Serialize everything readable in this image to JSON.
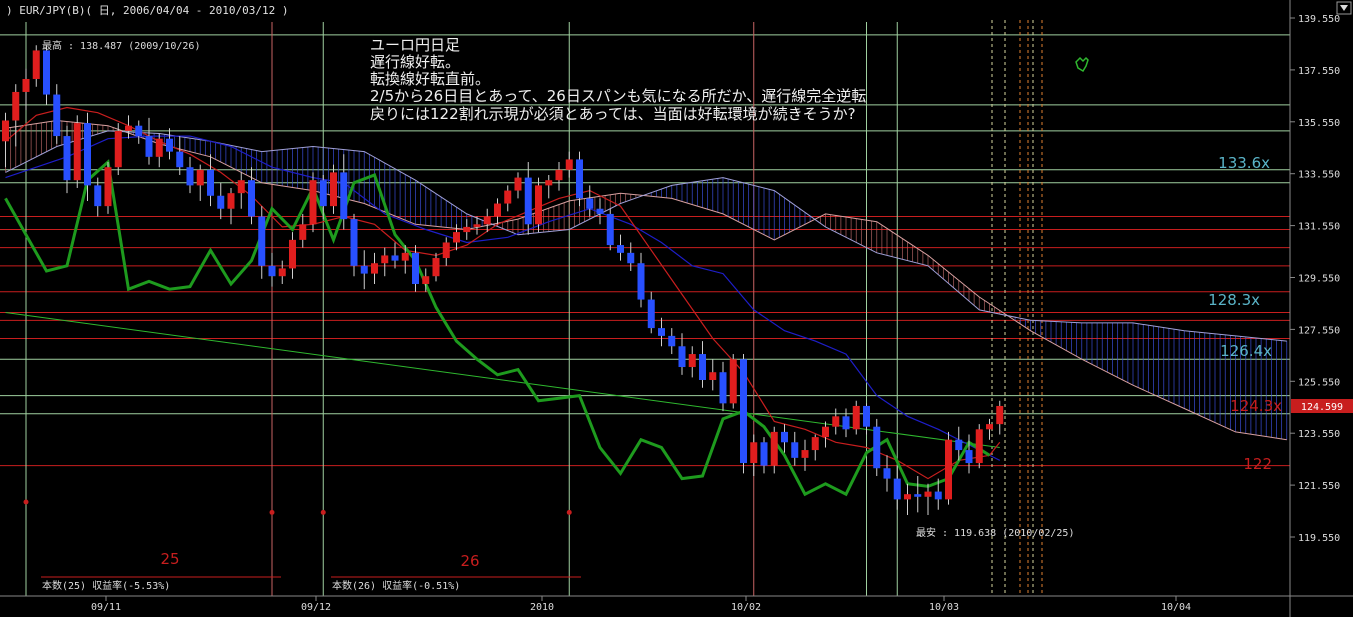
{
  "header": {
    "symbol_text": ")   EUR/JPY(B)( 日, 2006/04/04 - 2010/03/12 )",
    "menu_icon": "dropdown-triangle-icon"
  },
  "chart_data": {
    "type": "candlestick",
    "title": "",
    "ylim": [
      118.0,
      140.2
    ],
    "y_ticks": [
      139.55,
      137.55,
      135.55,
      133.55,
      131.55,
      129.55,
      127.55,
      125.55,
      123.55,
      121.55,
      119.55
    ],
    "y_tick_labels": [
      "139.550",
      "137.550",
      "135.550",
      "133.550",
      "131.550",
      "129.550",
      "127.550",
      "125.550",
      "123.550",
      "121.550",
      "119.550"
    ],
    "x_ticks": [
      "09/11",
      "09/12",
      "2010",
      "10/02",
      "10/03",
      "10/04"
    ],
    "current_price": "124.599",
    "high_label": "最高 : 138.487 (2009/10/26)",
    "low_label": "最安 : 119.638 (2010/02/25)",
    "annotation_lines": [
      "ユーロ円日足",
      "遅行線好転。",
      "転換線好転直前。",
      "2/5から26日目とあって、26日スパンも気になる所だか、遅行線完全逆転",
      "戻りには122割れ示現が必須とあっては、当面は好転環境が続きそうか?"
    ],
    "price_level_labels": [
      {
        "text": "133.6x",
        "value": 133.6,
        "color": "#5ab4c8"
      },
      {
        "text": "128.3x",
        "value": 128.3,
        "color": "#5ab4c8"
      },
      {
        "text": "126.4x",
        "value": 126.4,
        "color": "#5ab4c8"
      },
      {
        "text": "124.3x",
        "value": 124.3,
        "color": "#c81e1e"
      },
      {
        "text": "122",
        "value": 122.0,
        "color": "#c81e1e"
      }
    ],
    "cycle_labels": [
      {
        "text": "25",
        "color": "#c81e1e"
      },
      {
        "text": "26",
        "color": "#c81e1e"
      }
    ],
    "cycle_notes": [
      "本数(25) 収益率(-5.53%)",
      "本数(26) 収益率(-0.51%)"
    ],
    "horizontal_lines": [
      {
        "value": 138.9,
        "color": "#9fd09f"
      },
      {
        "value": 136.2,
        "color": "#9fd09f"
      },
      {
        "value": 135.2,
        "color": "#9fd09f"
      },
      {
        "value": 133.7,
        "color": "#9fd09f"
      },
      {
        "value": 133.2,
        "color": "#9fd09f"
      },
      {
        "value": 131.9,
        "color": "#c81e1e"
      },
      {
        "value": 131.4,
        "color": "#c81e1e"
      },
      {
        "value": 130.7,
        "color": "#c81e1e"
      },
      {
        "value": 130.0,
        "color": "#c81e1e"
      },
      {
        "value": 129.0,
        "color": "#c81e1e"
      },
      {
        "value": 128.2,
        "color": "#c81e1e"
      },
      {
        "value": 127.9,
        "color": "#c81e1e"
      },
      {
        "value": 127.2,
        "color": "#c81e1e"
      },
      {
        "value": 126.4,
        "color": "#9fd09f"
      },
      {
        "value": 125.0,
        "color": "#9fd09f"
      },
      {
        "value": 124.3,
        "color": "#9fd09f"
      },
      {
        "value": 122.3,
        "color": "#c81e1e"
      }
    ],
    "vertical_lines": [
      {
        "date_index": 2,
        "color": "#9fd09f"
      },
      {
        "date_index": 26,
        "color": "#c86464"
      },
      {
        "date_index": 31,
        "color": "#9fd09f"
      },
      {
        "date_index": 55,
        "color": "#9fd09f"
      },
      {
        "date_index": 73,
        "color": "#c86464"
      },
      {
        "date_index": 84,
        "color": "#9fd09f"
      },
      {
        "date_index": 87,
        "color": "#9fd09f"
      }
    ],
    "colors": {
      "up": "#e01e1e",
      "down": "#2850ff",
      "kijun": "#1e1ec8",
      "tenkan": "#c81e1e",
      "chikou": "#1e9b1e",
      "cloud_up": "#b46464",
      "cloud_down": "#3c50dc",
      "trendline": "#2fb82f"
    },
    "candles": [
      [
        134.8,
        135.9,
        133.8,
        135.6
      ],
      [
        135.6,
        137.0,
        134.6,
        136.7
      ],
      [
        136.7,
        137.6,
        136.0,
        137.2
      ],
      [
        137.2,
        138.5,
        136.9,
        138.3
      ],
      [
        138.3,
        138.5,
        136.2,
        136.6
      ],
      [
        136.6,
        137.0,
        134.7,
        135.0
      ],
      [
        135.0,
        135.4,
        132.8,
        133.3
      ],
      [
        133.3,
        135.8,
        133.0,
        135.5
      ],
      [
        135.5,
        135.9,
        132.5,
        133.1
      ],
      [
        133.1,
        133.4,
        131.9,
        132.3
      ],
      [
        132.3,
        134.0,
        132.0,
        133.8
      ],
      [
        133.8,
        135.5,
        133.5,
        135.2
      ],
      [
        135.2,
        135.8,
        134.9,
        135.4
      ],
      [
        135.4,
        135.6,
        134.7,
        135.0
      ],
      [
        135.0,
        135.7,
        133.9,
        134.2
      ],
      [
        134.2,
        135.1,
        133.8,
        134.9
      ],
      [
        134.9,
        135.3,
        134.1,
        134.4
      ],
      [
        134.4,
        135.0,
        133.5,
        133.8
      ],
      [
        133.8,
        134.2,
        132.8,
        133.1
      ],
      [
        133.1,
        133.9,
        132.5,
        133.7
      ],
      [
        133.7,
        134.3,
        132.3,
        132.7
      ],
      [
        132.7,
        133.2,
        131.8,
        132.2
      ],
      [
        132.2,
        133.0,
        131.6,
        132.8
      ],
      [
        132.8,
        133.6,
        132.2,
        133.3
      ],
      [
        133.3,
        133.8,
        131.6,
        131.9
      ],
      [
        131.9,
        132.3,
        129.5,
        130.0
      ],
      [
        130.0,
        130.5,
        129.2,
        129.6
      ],
      [
        129.6,
        130.2,
        129.3,
        129.9
      ],
      [
        129.9,
        131.3,
        129.5,
        131.0
      ],
      [
        131.0,
        132.0,
        130.7,
        131.6
      ],
      [
        131.6,
        133.6,
        131.3,
        133.3
      ],
      [
        133.3,
        133.5,
        131.8,
        132.3
      ],
      [
        132.3,
        133.9,
        132.0,
        133.6
      ],
      [
        133.6,
        134.3,
        131.4,
        131.8
      ],
      [
        131.8,
        132.0,
        129.6,
        130.0
      ],
      [
        130.0,
        130.6,
        129.1,
        129.7
      ],
      [
        129.7,
        130.5,
        129.3,
        130.1
      ],
      [
        130.1,
        130.7,
        129.6,
        130.4
      ],
      [
        130.4,
        130.9,
        129.9,
        130.2
      ],
      [
        130.2,
        130.8,
        129.7,
        130.5
      ],
      [
        130.5,
        130.8,
        129.0,
        129.3
      ],
      [
        129.3,
        129.9,
        129.0,
        129.6
      ],
      [
        129.6,
        130.5,
        129.4,
        130.3
      ],
      [
        130.3,
        131.1,
        130.0,
        130.9
      ],
      [
        130.9,
        131.6,
        130.6,
        131.3
      ],
      [
        131.3,
        131.8,
        131.0,
        131.5
      ],
      [
        131.5,
        131.9,
        131.2,
        131.6
      ],
      [
        131.6,
        132.2,
        131.3,
        131.9
      ],
      [
        131.9,
        132.6,
        131.6,
        132.4
      ],
      [
        132.4,
        133.1,
        132.1,
        132.9
      ],
      [
        132.9,
        133.6,
        132.6,
        133.4
      ],
      [
        133.4,
        134.0,
        131.2,
        131.6
      ],
      [
        131.6,
        133.4,
        131.3,
        133.1
      ],
      [
        133.1,
        133.5,
        132.6,
        133.3
      ],
      [
        133.3,
        134.0,
        132.9,
        133.7
      ],
      [
        133.7,
        134.4,
        133.4,
        134.1
      ],
      [
        134.1,
        134.4,
        132.3,
        132.6
      ],
      [
        132.6,
        133.1,
        131.9,
        132.2
      ],
      [
        132.2,
        132.6,
        131.6,
        132.0
      ],
      [
        132.0,
        132.2,
        130.6,
        130.8
      ],
      [
        130.8,
        131.2,
        130.2,
        130.5
      ],
      [
        130.5,
        130.9,
        129.8,
        130.1
      ],
      [
        130.1,
        130.5,
        128.4,
        128.7
      ],
      [
        128.7,
        129.0,
        127.4,
        127.6
      ],
      [
        127.6,
        128.0,
        126.9,
        127.3
      ],
      [
        127.3,
        127.6,
        126.6,
        126.9
      ],
      [
        126.9,
        127.4,
        125.8,
        126.1
      ],
      [
        126.1,
        126.9,
        125.7,
        126.6
      ],
      [
        126.6,
        127.1,
        125.3,
        125.6
      ],
      [
        125.6,
        126.4,
        125.2,
        125.9
      ],
      [
        125.9,
        126.3,
        124.4,
        124.7
      ],
      [
        124.7,
        126.6,
        124.5,
        126.4
      ],
      [
        126.4,
        126.6,
        122.0,
        122.4
      ],
      [
        122.4,
        123.5,
        121.9,
        123.2
      ],
      [
        123.2,
        123.4,
        122.0,
        122.3
      ],
      [
        122.3,
        123.8,
        122.0,
        123.6
      ],
      [
        123.6,
        123.9,
        122.8,
        123.2
      ],
      [
        123.2,
        123.6,
        122.3,
        122.6
      ],
      [
        122.6,
        123.3,
        122.1,
        122.9
      ],
      [
        122.9,
        123.5,
        122.5,
        123.4
      ],
      [
        123.4,
        124.0,
        123.0,
        123.8
      ],
      [
        123.8,
        124.5,
        123.5,
        124.2
      ],
      [
        124.2,
        124.5,
        123.4,
        123.7
      ],
      [
        123.7,
        124.8,
        123.5,
        124.6
      ],
      [
        124.6,
        124.7,
        123.5,
        123.8
      ],
      [
        123.8,
        124.1,
        121.9,
        122.2
      ],
      [
        122.2,
        122.7,
        121.3,
        121.8
      ],
      [
        121.8,
        122.3,
        120.6,
        121.0
      ],
      [
        121.0,
        121.6,
        120.4,
        121.2
      ],
      [
        121.2,
        121.9,
        120.5,
        121.1
      ],
      [
        121.1,
        121.6,
        120.4,
        121.3
      ],
      [
        121.3,
        121.8,
        120.6,
        121.0
      ],
      [
        121.0,
        123.6,
        120.8,
        123.3
      ],
      [
        123.3,
        123.8,
        122.5,
        122.9
      ],
      [
        122.9,
        123.5,
        122.0,
        122.4
      ],
      [
        122.4,
        123.9,
        122.2,
        123.7
      ],
      [
        123.7,
        124.1,
        123.3,
        123.9
      ],
      [
        123.9,
        124.8,
        123.5,
        124.6
      ]
    ],
    "tenkan": [
      [
        0,
        134.8
      ],
      [
        3,
        135.8
      ],
      [
        6,
        136.1
      ],
      [
        9,
        135.9
      ],
      [
        12,
        135.4
      ],
      [
        15,
        134.8
      ],
      [
        18,
        134.3
      ],
      [
        21,
        133.6
      ],
      [
        24,
        132.7
      ],
      [
        27,
        131.5
      ],
      [
        30,
        131.6
      ],
      [
        33,
        131.9
      ],
      [
        36,
        131.6
      ],
      [
        39,
        130.6
      ],
      [
        42,
        130.4
      ],
      [
        45,
        130.8
      ],
      [
        48,
        131.6
      ],
      [
        51,
        132.1
      ],
      [
        54,
        132.6
      ],
      [
        57,
        132.9
      ],
      [
        60,
        132.3
      ],
      [
        63,
        130.6
      ],
      [
        66,
        128.9
      ],
      [
        69,
        127.2
      ],
      [
        72,
        125.9
      ],
      [
        75,
        124.0
      ],
      [
        78,
        123.7
      ],
      [
        81,
        123.2
      ],
      [
        84,
        123.0
      ],
      [
        87,
        122.5
      ],
      [
        90,
        121.8
      ],
      [
        93,
        122.5
      ],
      [
        96,
        122.7
      ],
      [
        97,
        123.2
      ]
    ],
    "kijun": [
      [
        0,
        133.4
      ],
      [
        6,
        134.2
      ],
      [
        10,
        134.9
      ],
      [
        14,
        135.0
      ],
      [
        18,
        135.0
      ],
      [
        22,
        134.6
      ],
      [
        26,
        133.8
      ],
      [
        30,
        133.4
      ],
      [
        33,
        133.2
      ],
      [
        37,
        132.0
      ],
      [
        41,
        131.4
      ],
      [
        45,
        130.9
      ],
      [
        49,
        131.1
      ],
      [
        53,
        131.7
      ],
      [
        57,
        132.2
      ],
      [
        61,
        131.6
      ],
      [
        64,
        130.9
      ],
      [
        67,
        130.0
      ],
      [
        70,
        129.7
      ],
      [
        73,
        128.3
      ],
      [
        76,
        127.5
      ],
      [
        79,
        127.1
      ],
      [
        82,
        126.6
      ],
      [
        85,
        125.0
      ],
      [
        88,
        124.2
      ],
      [
        91,
        123.7
      ],
      [
        94,
        123.1
      ],
      [
        97,
        122.5
      ]
    ],
    "span_a": [
      [
        0,
        135.3
      ],
      [
        5,
        135.6
      ],
      [
        10,
        135.4
      ],
      [
        15,
        134.7
      ],
      [
        20,
        134.2
      ],
      [
        25,
        133.2
      ],
      [
        30,
        132.9
      ],
      [
        35,
        132.4
      ],
      [
        40,
        131.6
      ],
      [
        45,
        131.4
      ],
      [
        50,
        131.8
      ],
      [
        55,
        132.5
      ],
      [
        60,
        132.8
      ],
      [
        65,
        132.6
      ],
      [
        70,
        132.0
      ],
      [
        75,
        131.0
      ],
      [
        80,
        132.0
      ],
      [
        85,
        131.7
      ],
      [
        90,
        130.4
      ],
      [
        95,
        128.8
      ],
      [
        100,
        127.5
      ],
      [
        105,
        126.4
      ],
      [
        110,
        125.4
      ],
      [
        115,
        124.5
      ],
      [
        120,
        123.6
      ],
      [
        125,
        123.3
      ]
    ],
    "span_b": [
      [
        0,
        133.6
      ],
      [
        5,
        134.6
      ],
      [
        10,
        135.2
      ],
      [
        15,
        135.1
      ],
      [
        20,
        134.8
      ],
      [
        25,
        134.4
      ],
      [
        30,
        134.6
      ],
      [
        35,
        134.4
      ],
      [
        40,
        133.3
      ],
      [
        45,
        132.0
      ],
      [
        50,
        131.2
      ],
      [
        55,
        131.4
      ],
      [
        60,
        132.4
      ],
      [
        65,
        133.1
      ],
      [
        70,
        133.4
      ],
      [
        75,
        132.9
      ],
      [
        80,
        131.5
      ],
      [
        85,
        130.5
      ],
      [
        90,
        130.0
      ],
      [
        95,
        128.3
      ],
      [
        100,
        127.9
      ],
      [
        105,
        127.8
      ],
      [
        110,
        127.8
      ],
      [
        115,
        127.5
      ],
      [
        120,
        127.3
      ],
      [
        125,
        127.1
      ]
    ],
    "chikou": [
      [
        0,
        132.6
      ],
      [
        2,
        131.2
      ],
      [
        4,
        129.8
      ],
      [
        6,
        130.0
      ],
      [
        8,
        133.3
      ],
      [
        10,
        134.0
      ],
      [
        12,
        129.1
      ],
      [
        14,
        129.4
      ],
      [
        16,
        129.1
      ],
      [
        18,
        129.2
      ],
      [
        20,
        130.6
      ],
      [
        22,
        129.3
      ],
      [
        24,
        130.2
      ],
      [
        26,
        132.2
      ],
      [
        28,
        131.4
      ],
      [
        30,
        133.0
      ],
      [
        32,
        131.0
      ],
      [
        34,
        133.2
      ],
      [
        36,
        133.5
      ],
      [
        38,
        131.2
      ],
      [
        40,
        130.2
      ],
      [
        42,
        128.4
      ],
      [
        44,
        127.1
      ],
      [
        46,
        126.4
      ],
      [
        48,
        125.8
      ],
      [
        50,
        126.0
      ],
      [
        52,
        124.8
      ],
      [
        54,
        124.9
      ],
      [
        56,
        125.0
      ],
      [
        58,
        123.0
      ],
      [
        60,
        122.0
      ],
      [
        62,
        123.3
      ],
      [
        64,
        123.0
      ],
      [
        66,
        121.8
      ],
      [
        68,
        121.9
      ],
      [
        70,
        124.1
      ],
      [
        72,
        124.4
      ],
      [
        74,
        123.8
      ],
      [
        76,
        122.7
      ],
      [
        78,
        121.2
      ],
      [
        80,
        121.6
      ],
      [
        82,
        121.2
      ],
      [
        84,
        122.8
      ],
      [
        86,
        123.3
      ],
      [
        88,
        121.6
      ],
      [
        90,
        121.5
      ],
      [
        92,
        121.8
      ],
      [
        94,
        123.2
      ],
      [
        96,
        122.7
      ]
    ],
    "trendline": [
      [
        0,
        128.2
      ],
      [
        97,
        123.0
      ]
    ],
    "marker_dots": [
      {
        "index": 2,
        "value": 120.9
      },
      {
        "index": 26,
        "value": 120.5
      },
      {
        "index": 31,
        "value": 120.5
      },
      {
        "index": 55,
        "value": 120.5
      }
    ]
  }
}
